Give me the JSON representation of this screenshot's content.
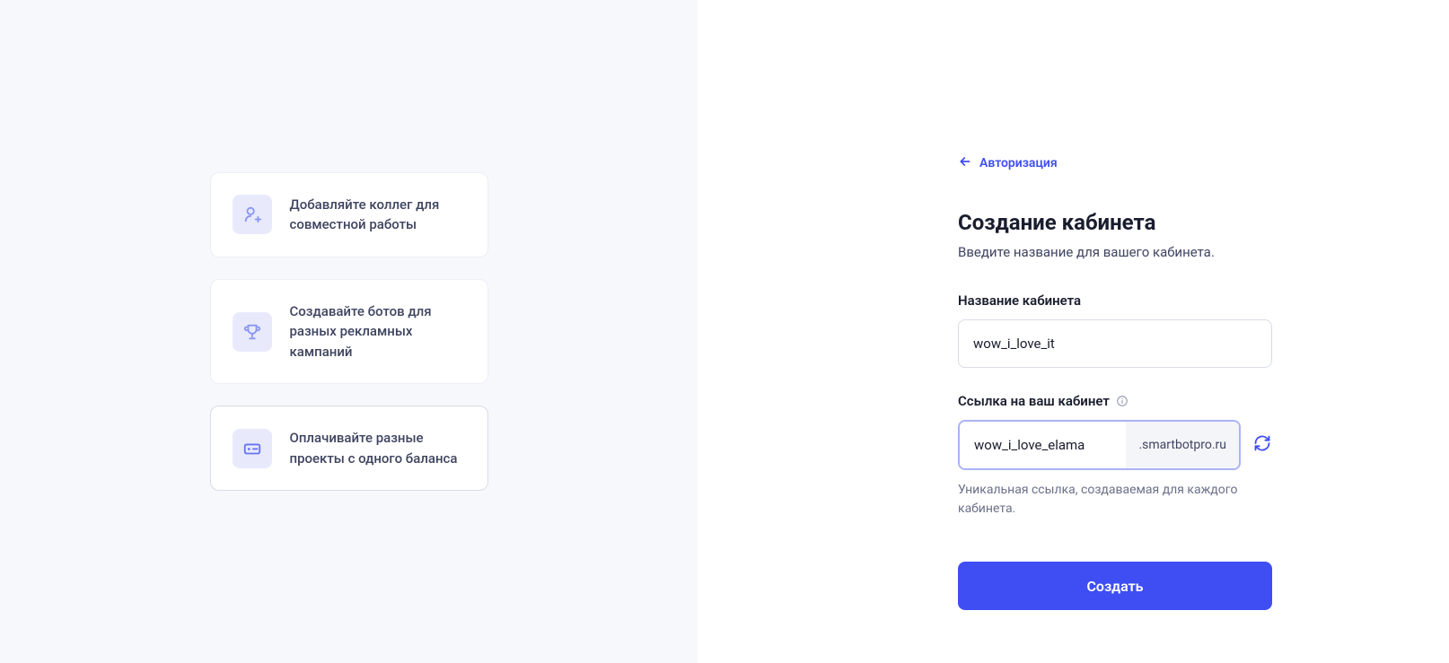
{
  "left": {
    "features": [
      {
        "text": "Добавляйте коллег для совместной работы"
      },
      {
        "text": "Создавайте ботов для разных рекламных кампаний"
      },
      {
        "text": "Оплачивайте разные проекты с одного баланса"
      }
    ]
  },
  "right": {
    "back_label": "Авторизация",
    "title": "Создание кабинета",
    "subtitle": "Введите название для вашего кабинета.",
    "name_label": "Название кабинета",
    "name_value": "wow_i_love_it",
    "url_label": "Ссылка на ваш кабинет",
    "url_value": "wow_i_love_elama",
    "url_suffix": ".smartbotpro.ru",
    "url_hint": "Уникальная ссылка, создаваемая для каждого кабинета.",
    "submit_label": "Создать"
  }
}
